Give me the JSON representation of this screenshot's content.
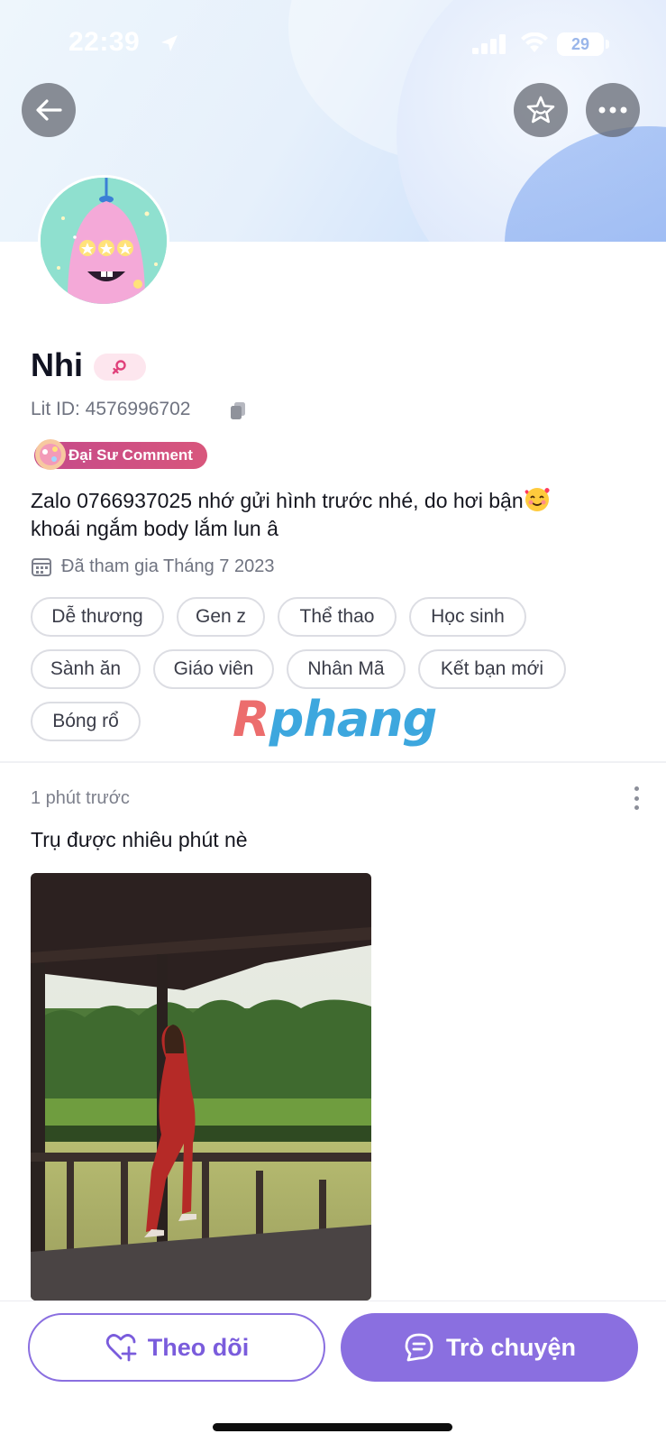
{
  "status_bar": {
    "time": "22:39",
    "battery": "29"
  },
  "header": {
    "back_icon": "arrow-left-icon",
    "favorite_icon": "star-icon",
    "more_icon": "more-horizontal-icon"
  },
  "profile": {
    "name": "Nhi",
    "gender_icon": "female-symbol-icon",
    "lit_id": "Lit ID: 4576996702",
    "badge": "Đại Sư Comment",
    "bio_line1": "Zalo 0766937025 nhớ gửi hình trước nhé, do hơi bận",
    "bio_line2": "khoái ngắm body lắm lun â",
    "joined": "Đã tham gia Tháng 7 2023",
    "tags": [
      "Dễ thương",
      "Gen z",
      "Thể thao",
      "Học sinh",
      "Sành ăn",
      "Giáo viên",
      "Nhân Mã",
      "Kết bạn mới",
      "Bóng rổ"
    ]
  },
  "watermark": {
    "first": "R",
    "rest": "phang"
  },
  "post": {
    "time": "1 phút trước",
    "text": "Trụ được nhiêu phút nè"
  },
  "actions": {
    "follow_label": "Theo dõi",
    "chat_label": "Trò chuyện"
  },
  "colors": {
    "accent": "#8a6fe0",
    "badge": "#d8567c",
    "watermark_red": "#ec6d6d",
    "watermark_blue": "#3da7de"
  }
}
